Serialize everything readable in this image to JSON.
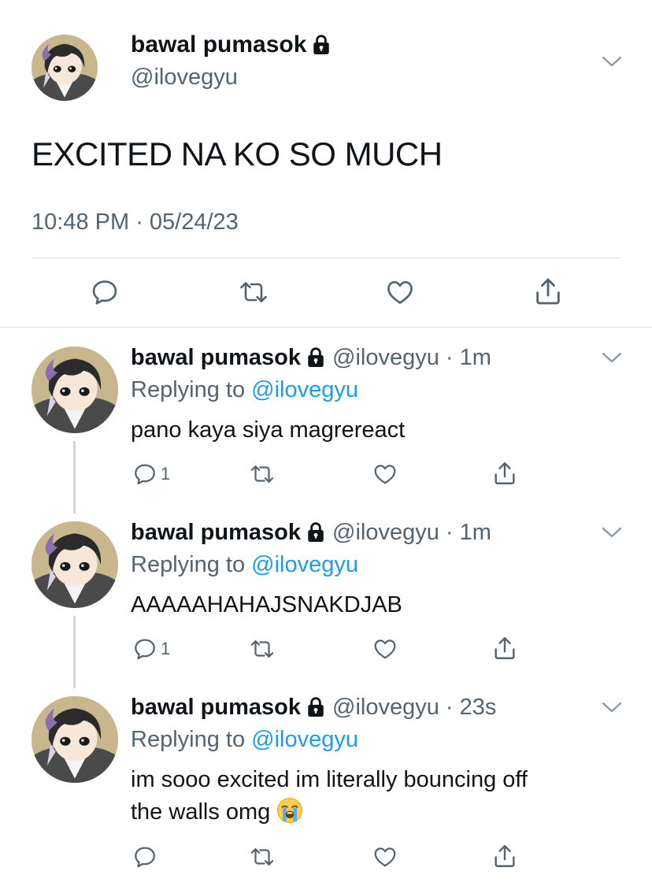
{
  "main_tweet": {
    "author_name": "bawal pumasok",
    "handle": "@ilovegyu",
    "text": "EXCITED NA KO SO MUCH",
    "timestamp": "10:48 PM · 05/24/23",
    "author_icon": "lock-icon"
  },
  "replies": [
    {
      "author_name": "bawal pumasok",
      "handle_time": "@ilovegyu · 1m",
      "replying_prefix": "Replying to ",
      "replying_to": "@ilovegyu",
      "text_lines": [
        "pano kaya siya magrereact"
      ],
      "reply_count": "1"
    },
    {
      "author_name": "bawal pumasok",
      "handle_time": "@ilovegyu · 1m",
      "replying_prefix": "Replying to ",
      "replying_to": "@ilovegyu",
      "text_lines": [
        "AAAAAHAHAJSNAKDJAB"
      ],
      "reply_count": "1"
    },
    {
      "author_name": "bawal pumasok",
      "handle_time": "@ilovegyu · 23s",
      "replying_prefix": "Replying to ",
      "replying_to": "@ilovegyu",
      "text_lines": [
        "im sooo excited im literally bouncing off",
        "the walls omg"
      ],
      "text_emoji": "loudly-crying-face-emoji",
      "reply_count": ""
    }
  ],
  "colors": {
    "text_primary": "#0f1419",
    "text_secondary": "#536471",
    "link": "#1d9bf0",
    "divider": "#dfe3e6",
    "thread_line": "#cfd9de"
  }
}
